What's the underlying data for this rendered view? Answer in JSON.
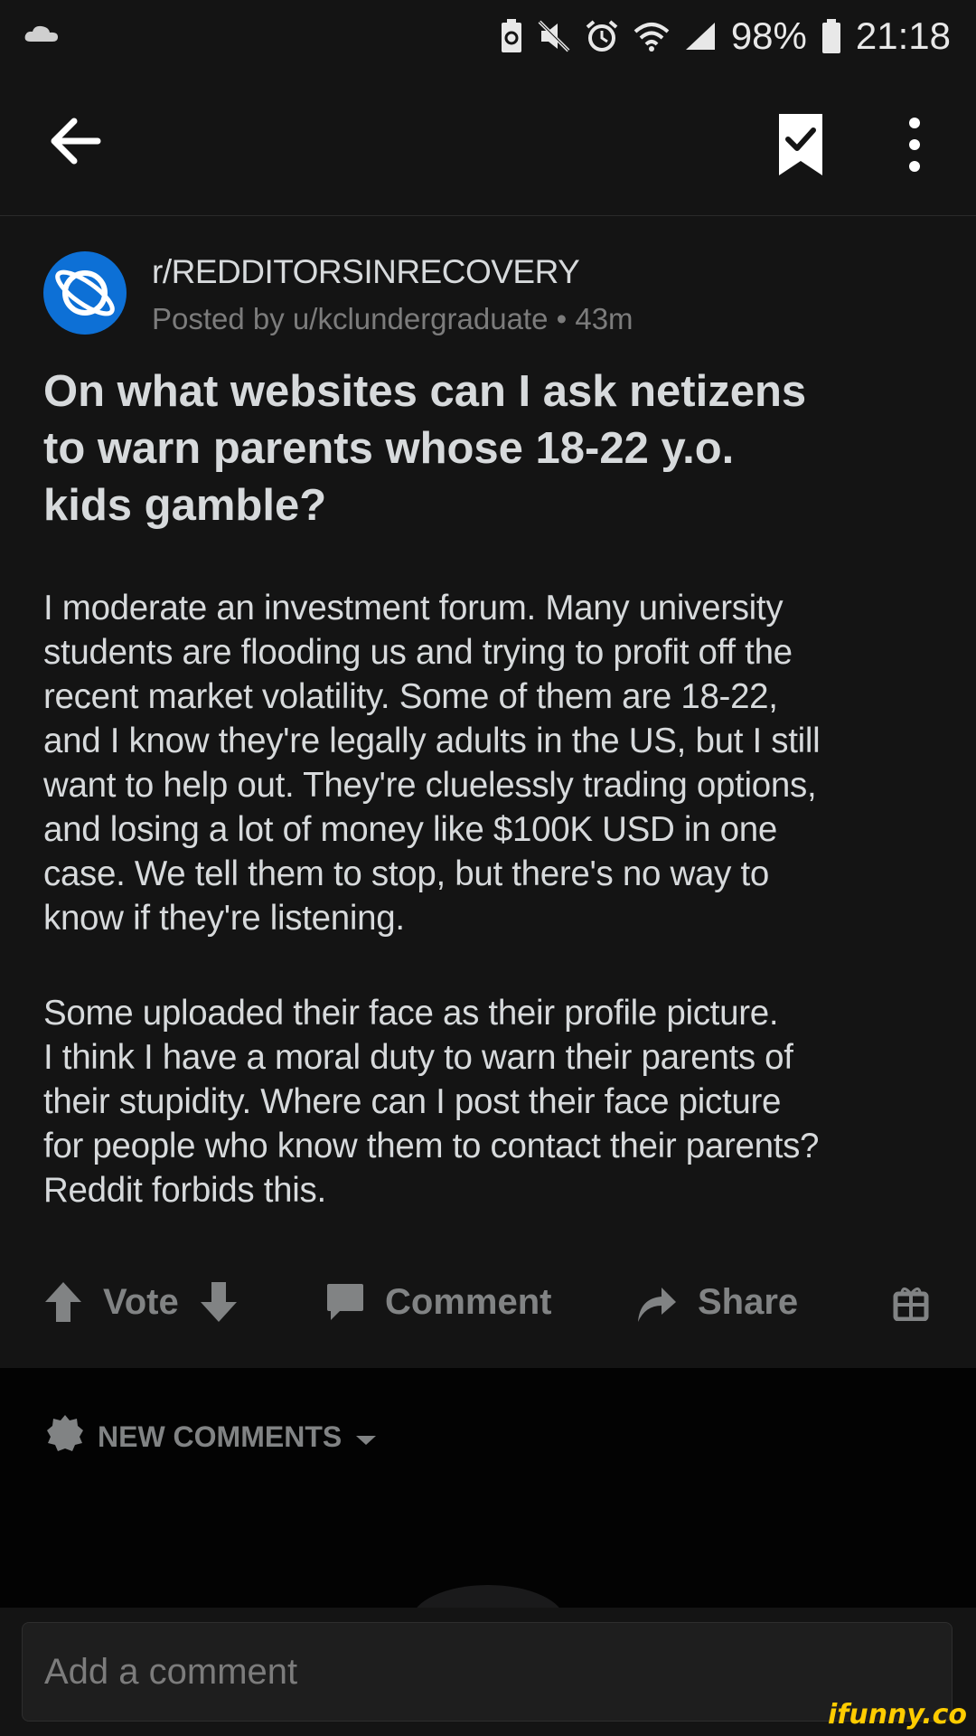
{
  "status_bar": {
    "battery_percent": "98%",
    "time": "21:18"
  },
  "post": {
    "subreddit": "r/REDDITORSINRECOVERY",
    "posted_by": "Posted by u/kclundergraduate • 43m",
    "title_lines": [
      "On what websites can I ask netizens",
      "to warn parents whose 18-22 y.o.",
      "kids gamble?"
    ],
    "paragraph1_lines": [
      "I moderate an investment forum. Many university",
      "students are flooding us and trying to profit off the",
      "recent market volatility. Some of them are 18-22,",
      "and I know they're legally adults in the US, but I still",
      "want to help out. They're cluelessly trading options,",
      "and losing a lot of money like $100K USD in one",
      "case. We  tell them to stop, but there's no way to",
      "know if they're listening."
    ],
    "paragraph2_lines": [
      "Some uploaded their face as their profile picture.",
      "I think I have a moral duty to warn their parents of",
      "their stupidity. Where can I post their face picture",
      "for people who know them to contact their parents?",
      "Reddit forbids this."
    ]
  },
  "actions": {
    "vote_label": "Vote",
    "comment_label": "Comment",
    "share_label": "Share"
  },
  "comments": {
    "sort_label": "NEW COMMENTS"
  },
  "composer": {
    "placeholder": "Add a comment"
  },
  "watermark": "ifunny.co",
  "colors": {
    "background": "#141414",
    "avatar": "#0d70d6",
    "muted": "#818384",
    "watermark": "#ffcc00"
  }
}
